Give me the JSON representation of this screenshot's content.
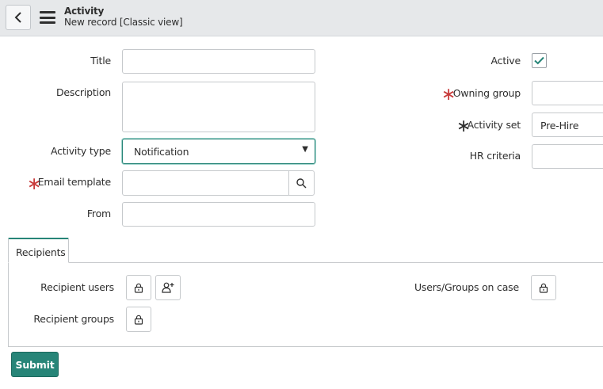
{
  "header": {
    "title": "Activity",
    "subtitle": "New record [Classic view]"
  },
  "form": {
    "title_label": "Title",
    "title_value": "",
    "description_label": "Description",
    "description_value": "",
    "activity_type_label": "Activity type",
    "activity_type_value": "Notification",
    "email_template_label": "Email template",
    "email_template_value": "",
    "from_label": "From",
    "from_value": "",
    "active_label": "Active",
    "active_checked": true,
    "owning_group_label": "Owning group",
    "owning_group_value": "",
    "activity_set_label": "Activity set",
    "activity_set_value": "Pre-Hire",
    "hr_criteria_label": "HR criteria",
    "hr_criteria_value": "",
    "required_marker": "∗"
  },
  "tabs": {
    "recipients_label": "Recipients"
  },
  "recipients": {
    "recipient_users_label": "Recipient users",
    "recipient_groups_label": "Recipient groups",
    "users_groups_on_case_label": "Users/Groups on case"
  },
  "actions": {
    "submit_label": "Submit"
  },
  "colors": {
    "accent": "#278578",
    "required_red": "#c83c3c",
    "header_bg": "#e6e8ea"
  },
  "icons": {
    "back": "chevron-left-icon",
    "menu": "hamburger-menu-icon",
    "search": "search-icon",
    "check": "checkmark-icon",
    "lock": "lock-icon",
    "add_me": "add-user-icon",
    "dropdown": "caret-down-icon"
  }
}
